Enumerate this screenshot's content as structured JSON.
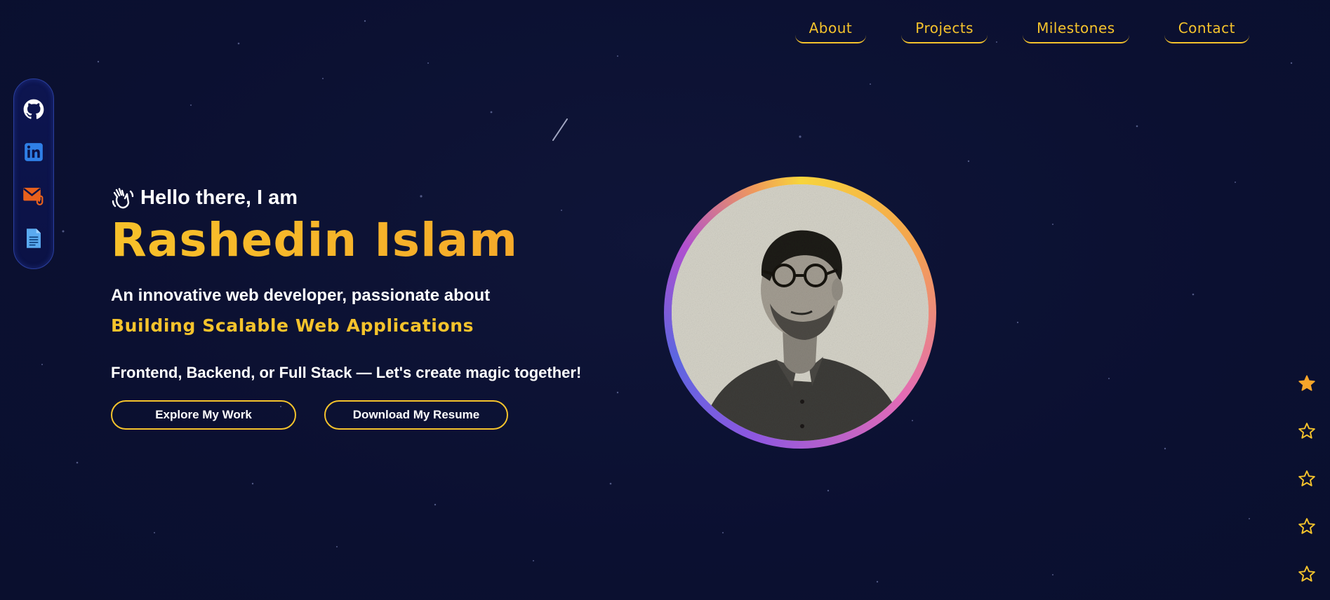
{
  "nav": {
    "items": [
      {
        "label": "About"
      },
      {
        "label": "Projects"
      },
      {
        "label": "Milestones"
      },
      {
        "label": "Contact"
      }
    ]
  },
  "social": {
    "items": [
      {
        "icon": "github-icon"
      },
      {
        "icon": "linkedin-icon"
      },
      {
        "icon": "email-icon"
      },
      {
        "icon": "document-icon"
      }
    ]
  },
  "hero": {
    "greeting": "Hello there, I am",
    "greeting_icon": "waving-hand-icon",
    "name": "Rashedin Islam",
    "tagline": "An innovative web developer, passionate about",
    "specialty": "Building Scalable Web Applications",
    "cta_text": "Frontend, Backend, or Full Stack — Let's create magic together!",
    "explore_label": "Explore My Work",
    "resume_label": "Download My Resume"
  },
  "rating": {
    "max": 5,
    "value": 1
  },
  "colors": {
    "background": "#0c1133",
    "accent": "#f5c32c",
    "name_gradient_end": "#f6a52a",
    "text": "#ffffff"
  }
}
